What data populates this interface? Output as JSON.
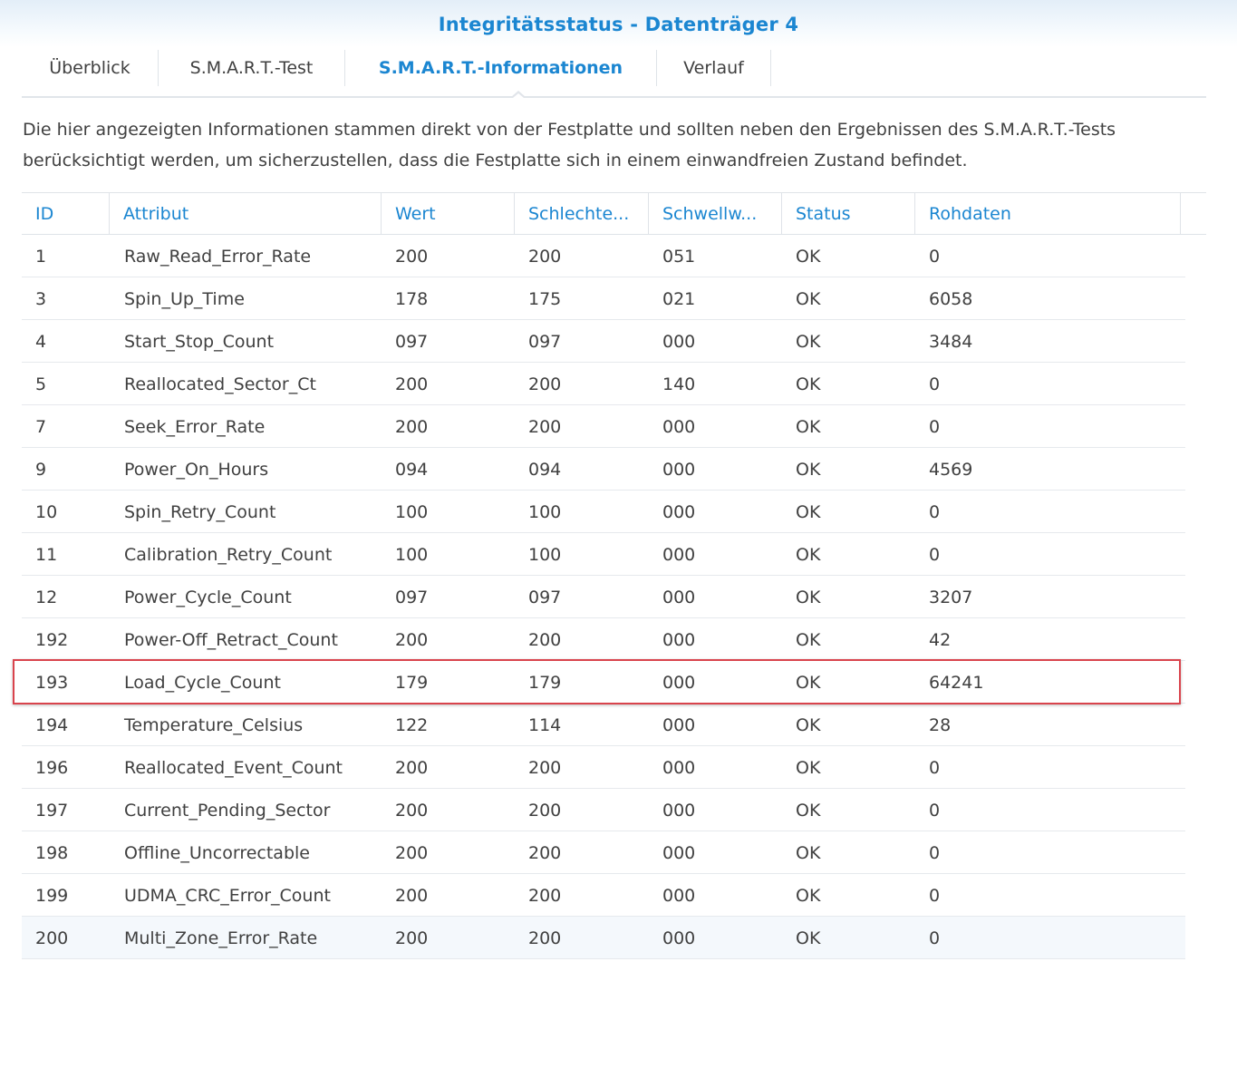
{
  "window": {
    "title": "Integritätsstatus - Datenträger 4"
  },
  "tabs": [
    {
      "label": "Überblick",
      "active": false
    },
    {
      "label": "S.M.A.R.T.-Test",
      "active": false
    },
    {
      "label": "S.M.A.R.T.-Informationen",
      "active": true
    },
    {
      "label": "Verlauf",
      "active": false
    }
  ],
  "description": "Die hier angezeigten Informationen stammen direkt von der Festplatte und sollten neben den Ergebnissen des S.M.A.R.T.-Tests berücksichtigt werden, um sicherzustellen, dass die Festplatte sich in einem einwandfreien Zustand befindet.",
  "table": {
    "columns": [
      "ID",
      "Attribut",
      "Wert",
      "Schlechte...",
      "Schwellw...",
      "Status",
      "Rohdaten"
    ],
    "rows": [
      [
        "1",
        "Raw_Read_Error_Rate",
        "200",
        "200",
        "051",
        "OK",
        "0"
      ],
      [
        "3",
        "Spin_Up_Time",
        "178",
        "175",
        "021",
        "OK",
        "6058"
      ],
      [
        "4",
        "Start_Stop_Count",
        "097",
        "097",
        "000",
        "OK",
        "3484"
      ],
      [
        "5",
        "Reallocated_Sector_Ct",
        "200",
        "200",
        "140",
        "OK",
        "0"
      ],
      [
        "7",
        "Seek_Error_Rate",
        "200",
        "200",
        "000",
        "OK",
        "0"
      ],
      [
        "9",
        "Power_On_Hours",
        "094",
        "094",
        "000",
        "OK",
        "4569"
      ],
      [
        "10",
        "Spin_Retry_Count",
        "100",
        "100",
        "000",
        "OK",
        "0"
      ],
      [
        "11",
        "Calibration_Retry_Count",
        "100",
        "100",
        "000",
        "OK",
        "0"
      ],
      [
        "12",
        "Power_Cycle_Count",
        "097",
        "097",
        "000",
        "OK",
        "3207"
      ],
      [
        "192",
        "Power-Off_Retract_Count",
        "200",
        "200",
        "000",
        "OK",
        "42"
      ],
      [
        "193",
        "Load_Cycle_Count",
        "179",
        "179",
        "000",
        "OK",
        "64241"
      ],
      [
        "194",
        "Temperature_Celsius",
        "122",
        "114",
        "000",
        "OK",
        "28"
      ],
      [
        "196",
        "Reallocated_Event_Count",
        "200",
        "200",
        "000",
        "OK",
        "0"
      ],
      [
        "197",
        "Current_Pending_Sector",
        "200",
        "200",
        "000",
        "OK",
        "0"
      ],
      [
        "198",
        "Offline_Uncorrectable",
        "200",
        "200",
        "000",
        "OK",
        "0"
      ],
      [
        "199",
        "UDMA_CRC_Error_Count",
        "200",
        "200",
        "000",
        "OK",
        "0"
      ],
      [
        "200",
        "Multi_Zone_Error_Rate",
        "200",
        "200",
        "000",
        "OK",
        "0"
      ]
    ],
    "highlighted_row_id": "193"
  },
  "colors": {
    "accent": "#1b86d1",
    "text": "#404040",
    "highlight_border": "#d9444d"
  }
}
